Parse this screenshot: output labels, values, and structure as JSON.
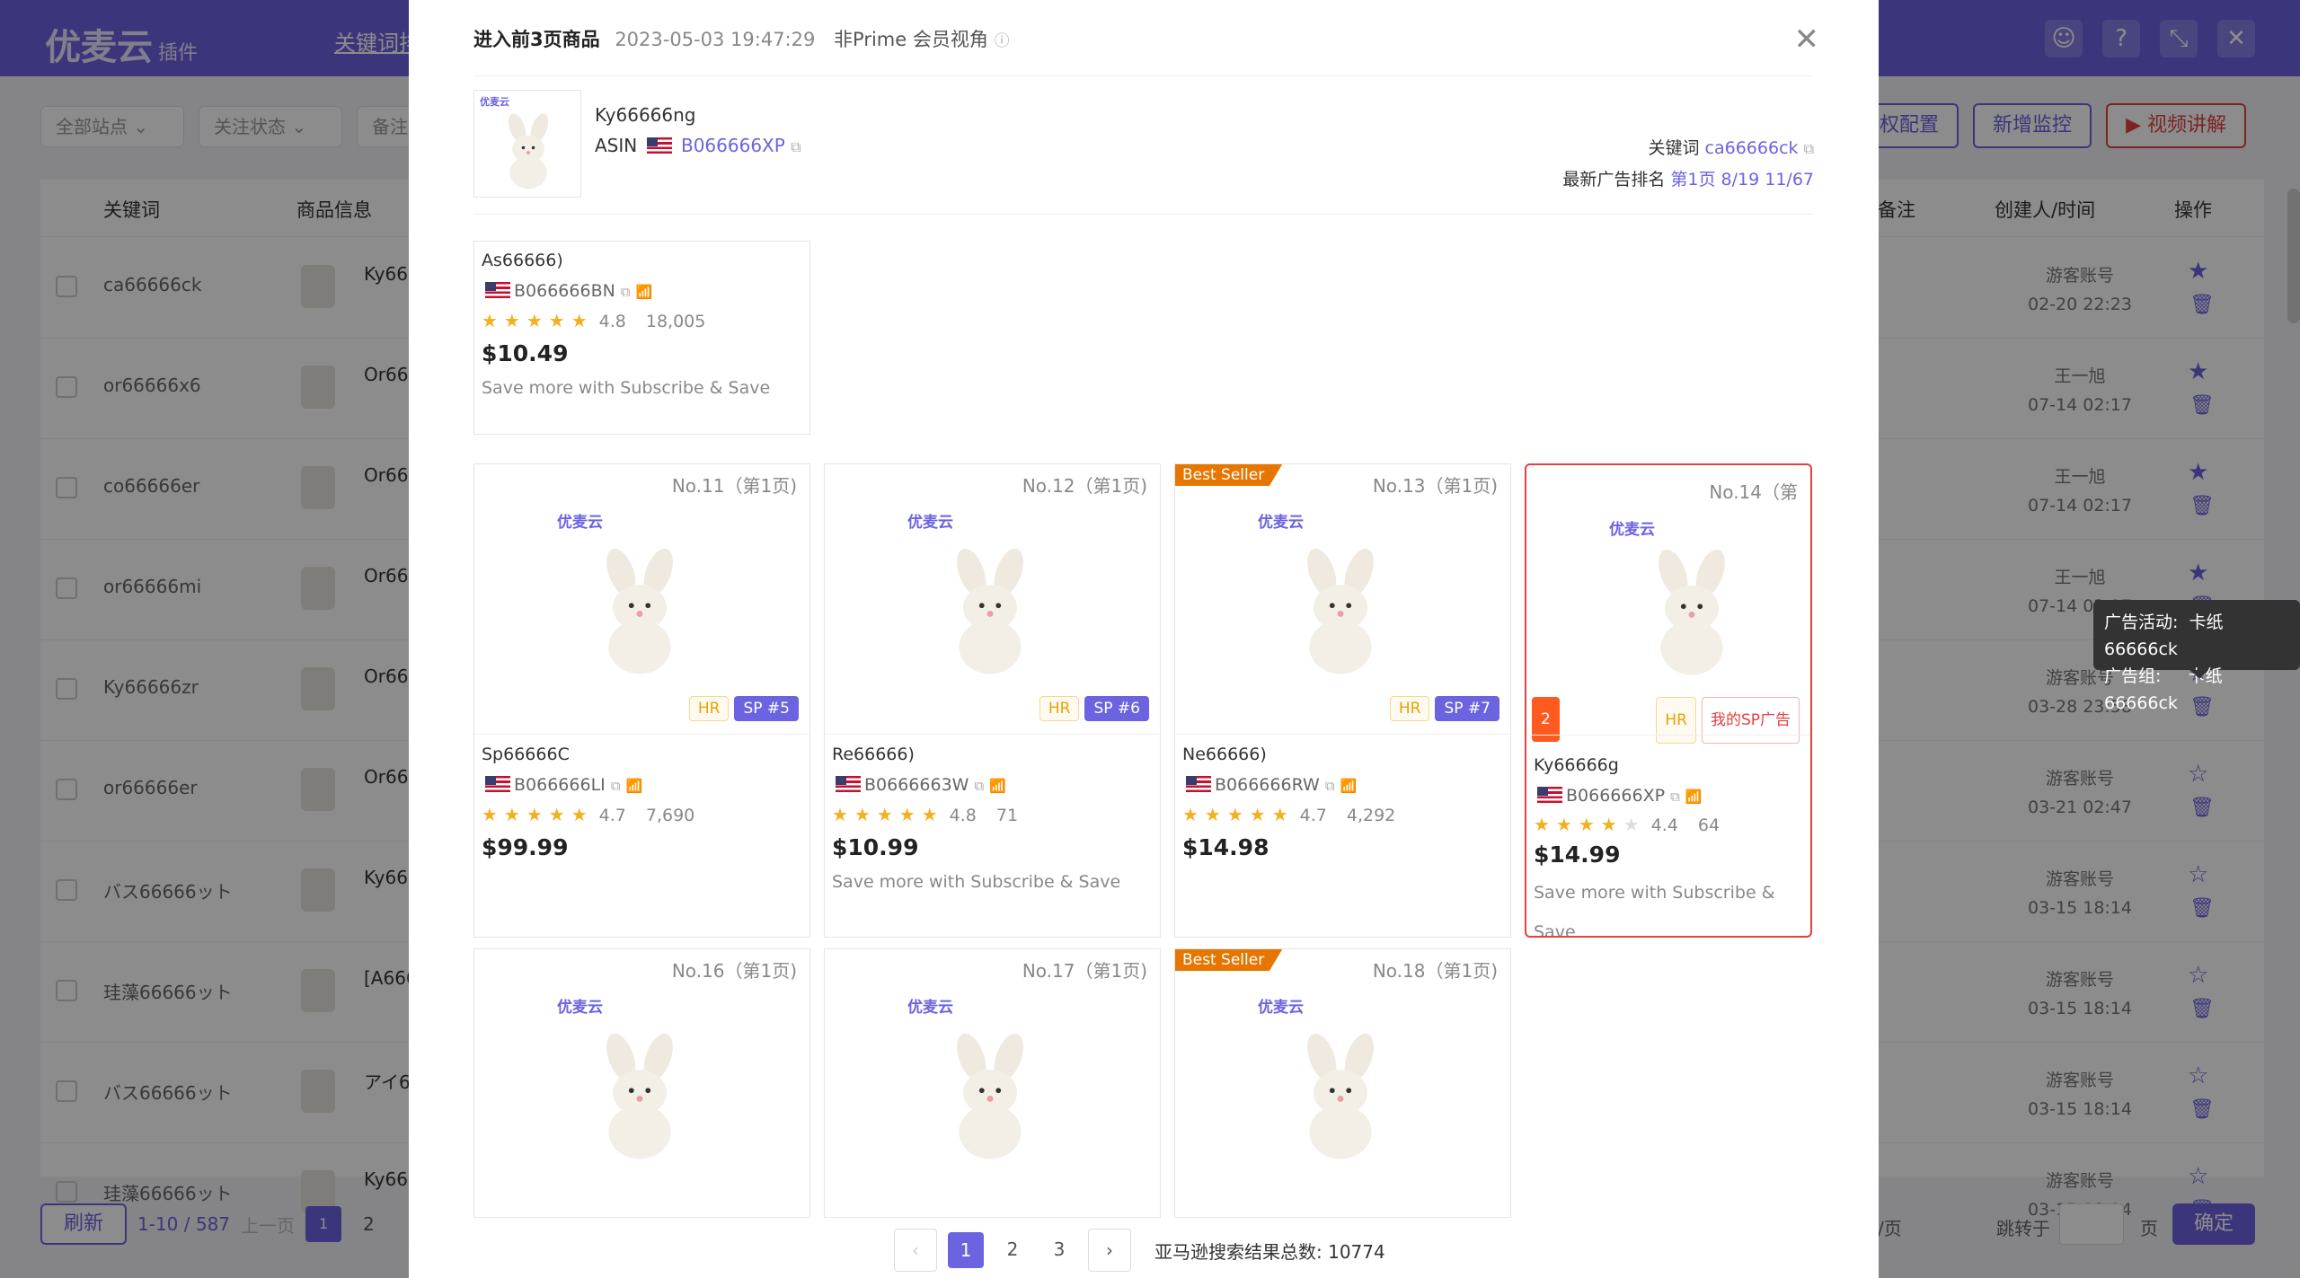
{
  "app": {
    "brand": "优麦云",
    "brand_tag": "插件",
    "tab": "关键词排",
    "filters": [
      "全部站点",
      "关注状态",
      "备注"
    ],
    "right_buttons": [
      "权配置",
      "新增监控",
      "视频讲解"
    ],
    "columns": [
      "关键词",
      "商品信息",
      "备注",
      "创建人/时间",
      "操作"
    ],
    "rows": [
      {
        "kw": "ca66666ck",
        "prod": "Ky666",
        "user": "游客账号",
        "time": "02-20 22:23",
        "fav": true
      },
      {
        "kw": "or66666x6",
        "prod": "Or666",
        "user": "王一旭",
        "time": "07-14 02:17",
        "fav": true
      },
      {
        "kw": "co66666er",
        "prod": "Or666",
        "user": "王一旭",
        "time": "07-14 02:17",
        "fav": true
      },
      {
        "kw": "or66666mi",
        "prod": "Or666",
        "user": "王一旭",
        "time": "07-14 02:17",
        "fav": true
      },
      {
        "kw": "Ky66666zr",
        "prod": "Or666",
        "user": "游客账号",
        "time": "03-28 23:58",
        "fav": false
      },
      {
        "kw": "or66666er",
        "prod": "Or666",
        "user": "游客账号",
        "time": "03-21 02:47",
        "fav": false
      },
      {
        "kw": "バス66666ット",
        "prod": "Ky666",
        "user": "游客账号",
        "time": "03-15 18:14",
        "fav": false
      },
      {
        "kw": "珪藻66666ット",
        "prod": "[A666",
        "user": "游客账号",
        "time": "03-15 18:14",
        "fav": false
      },
      {
        "kw": "バス66666ット",
        "prod": "アイ66",
        "user": "游客账号",
        "time": "03-15 18:14",
        "fav": false
      },
      {
        "kw": "珪藻66666ット",
        "prod": "Ky666",
        "user": "游客账号",
        "time": "03-15 18:14",
        "fav": false
      }
    ],
    "footer": {
      "refresh": "刷新",
      "range": "1-10 / 587",
      "prev": "上一页",
      "page1": "1",
      "page2": "2",
      "per_page": "/页",
      "jump": "跳转于",
      "page_unit": "页",
      "confirm": "确定"
    }
  },
  "modal": {
    "title": "进入前3页商品",
    "timestamp": "2023-05-03 19:47:29",
    "view": "非Prime 会员视角",
    "top_product": {
      "name": "Ky66666ng",
      "asin_label": "ASIN",
      "asin": "B066666XP"
    },
    "keyword_label": "关键词",
    "keyword": "ca66666ck",
    "ad_rank_label": "最新广告排名",
    "ad_rank": "第1页 8/19 11/67",
    "watermark": "优麦云",
    "cards": [
      {
        "name": "As66666)",
        "asin": "B066666BN",
        "rating": "4.8",
        "count": "18,005",
        "price": "$10.49",
        "sns": "Save more with Subscribe & Save"
      },
      {
        "no": "No.11（第1页)",
        "name": "Sp66666C",
        "asin": "B066666LI",
        "rating": "4.7",
        "count": "7,690",
        "price": "$99.99",
        "sns": "",
        "hr": "HR",
        "sp": "SP #5"
      },
      {
        "no": "No.12（第1页)",
        "name": "Re66666)",
        "asin": "B0666663W",
        "rating": "4.8",
        "count": "71",
        "price": "$10.99",
        "sns": "Save more with Subscribe & Save",
        "hr": "HR",
        "sp": "SP #6"
      },
      {
        "no": "No.13（第1页)",
        "bs": "Best Seller",
        "name": "Ne66666)",
        "asin": "B066666RW",
        "rating": "4.7",
        "count": "4,292",
        "price": "$14.98",
        "sns": "",
        "hr": "HR",
        "sp": "SP #7"
      },
      {
        "no": "No.14（第",
        "rank": "2",
        "name": "Ky66666g",
        "asin": "B066666XP",
        "rating": "4.4",
        "count": "64",
        "price": "$14.99",
        "sns": "Save more with Subscribe & Save",
        "hr": "HR",
        "my": "我的SP广告"
      },
      {
        "no": "No.16（第1页)"
      },
      {
        "no": "No.17（第1页)"
      },
      {
        "no": "No.18（第1页)",
        "bs": "Best Seller"
      }
    ],
    "tooltip": {
      "campaign_label": "广告活动:",
      "campaign": "卡纸66666ck",
      "group_label": "广告组:",
      "group": "卡纸66666ck"
    },
    "pager": {
      "p1": "1",
      "p2": "2",
      "p3": "3",
      "total_label": "亚马逊搜索结果总数:",
      "total": "10774"
    }
  }
}
